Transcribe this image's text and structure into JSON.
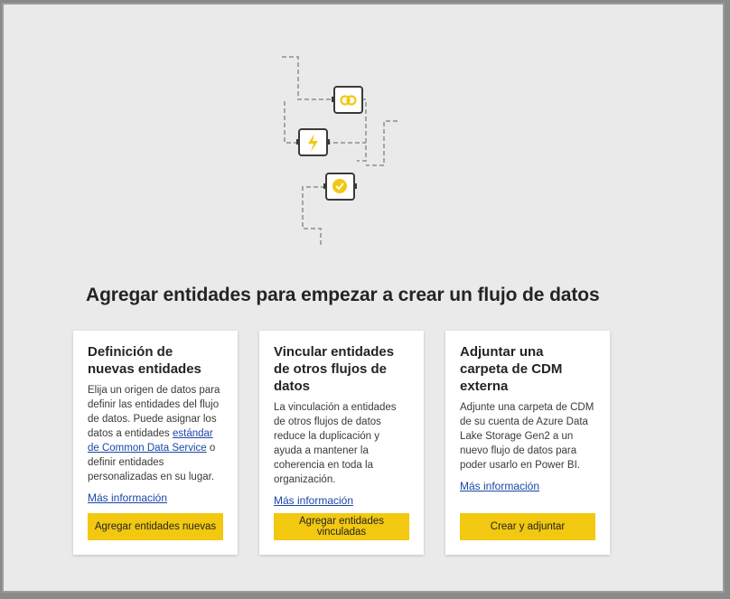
{
  "headline": "Agregar entidades para empezar a crear un flujo de datos",
  "colors": {
    "accent": "#f2c811",
    "link": "#1a47a6",
    "background": "#eaeaea"
  },
  "illustration_icons": [
    "link-icon",
    "lightning-icon",
    "certified-badge-icon"
  ],
  "cards": [
    {
      "title": "Definición de nuevas entidades",
      "desc_before": "Elija un origen de datos para definir las entidades del flujo de datos. Puede asignar los datos a entidades ",
      "desc_link": "estándar de Common Data Service",
      "desc_after": " o definir entidades personalizadas en su lugar.",
      "more": "Más información",
      "button": "Agregar entidades nuevas"
    },
    {
      "title": "Vincular entidades de otros flujos de datos",
      "desc": "La vinculación a entidades de otros flujos de datos reduce la duplicación y ayuda a mantener la coherencia en toda la organización.",
      "more": "Más información",
      "button": "Agregar entidades vinculadas"
    },
    {
      "title": "Adjuntar una carpeta de CDM externa",
      "desc": "Adjunte una carpeta de CDM de su cuenta de Azure Data Lake Storage Gen2 a un nuevo flujo de datos para poder usarlo en Power BI.",
      "more": "Más información",
      "button": "Crear y adjuntar"
    }
  ]
}
